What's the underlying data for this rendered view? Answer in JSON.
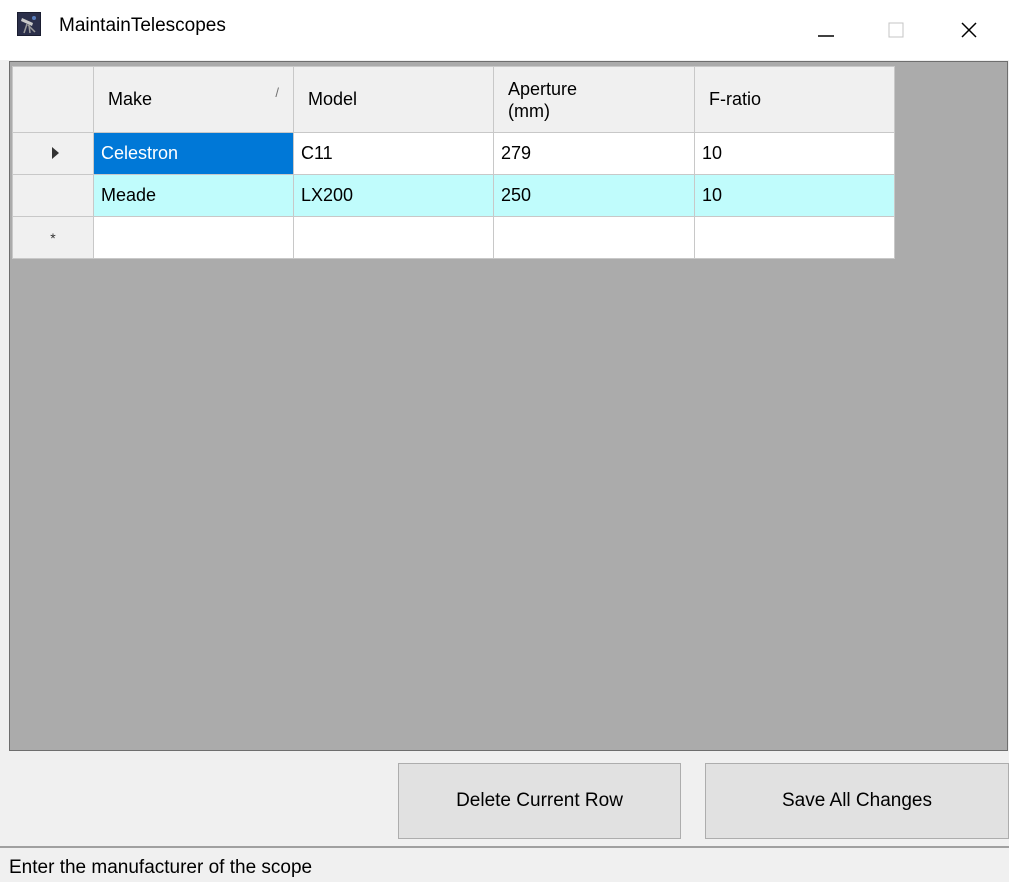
{
  "window": {
    "title": "MaintainTelescopes",
    "icon": "telescope-app-icon"
  },
  "grid": {
    "columns": [
      {
        "label": "Make",
        "sorted": true
      },
      {
        "label": "Model"
      },
      {
        "label_line1": "Aperture",
        "label_line2": "(mm)"
      },
      {
        "label": "F-ratio"
      }
    ],
    "rows": [
      {
        "make": "Celestron",
        "model": "C11",
        "aperture": "279",
        "f_ratio": "10",
        "current": true
      },
      {
        "make": "Meade",
        "model": "LX200",
        "aperture": "250",
        "f_ratio": "10",
        "current": false
      }
    ],
    "new_row_marker": "*",
    "colors": {
      "selected_cell": "#0078d7",
      "alternate_row": "#c0fcfc",
      "background": "#ababab"
    }
  },
  "buttons": {
    "delete_label": "Delete Current Row",
    "save_label": "Save All Changes"
  },
  "status": {
    "text": "Enter the manufacturer of the scope"
  }
}
